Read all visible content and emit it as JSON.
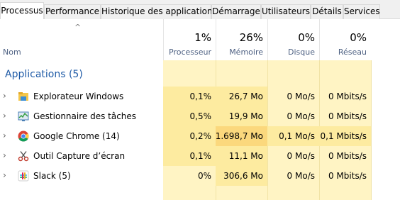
{
  "tabs": [
    "Processus",
    "Performance",
    "Historique des applications",
    "Démarrage",
    "Utilisateurs",
    "Détails",
    "Services"
  ],
  "header": {
    "name_label": "Nom",
    "columns": [
      {
        "pct": "1%",
        "label": "Processeur"
      },
      {
        "pct": "26%",
        "label": "Mémoire"
      },
      {
        "pct": "0%",
        "label": "Disque"
      },
      {
        "pct": "0%",
        "label": "Réseau"
      }
    ]
  },
  "group": {
    "title": "Applications (5)"
  },
  "rows": [
    {
      "name": "Explorateur Windows",
      "icon": "folder-icon",
      "cpu": "0,1%",
      "mem": "26,7 Mo",
      "disk": "0 Mo/s",
      "net": "0 Mbits/s"
    },
    {
      "name": "Gestionnaire des tâches",
      "icon": "task-manager-icon",
      "cpu": "0,5%",
      "mem": "19,9 Mo",
      "disk": "0 Mo/s",
      "net": "0 Mbits/s"
    },
    {
      "name": "Google Chrome (14)",
      "icon": "chrome-icon",
      "cpu": "0,2%",
      "mem": "1.698,7 Mo",
      "disk": "0,1 Mo/s",
      "net": "0,1 Mbits/s"
    },
    {
      "name": "Outil Capture d’écran",
      "icon": "scissors-icon",
      "cpu": "0,1%",
      "mem": "11,1 Mo",
      "disk": "0 Mo/s",
      "net": "0 Mbits/s"
    },
    {
      "name": "Slack (5)",
      "icon": "slack-icon",
      "cpu": "0%",
      "mem": "306,6 Mo",
      "disk": "0 Mo/s",
      "net": "0 Mbits/s"
    }
  ],
  "colors": {
    "header_text": "#4d6082",
    "group_title": "#1e5aa6",
    "heat_low": "#fff4c4",
    "heat_mid": "#fdeba0",
    "heat_high": "#fbd87d"
  }
}
